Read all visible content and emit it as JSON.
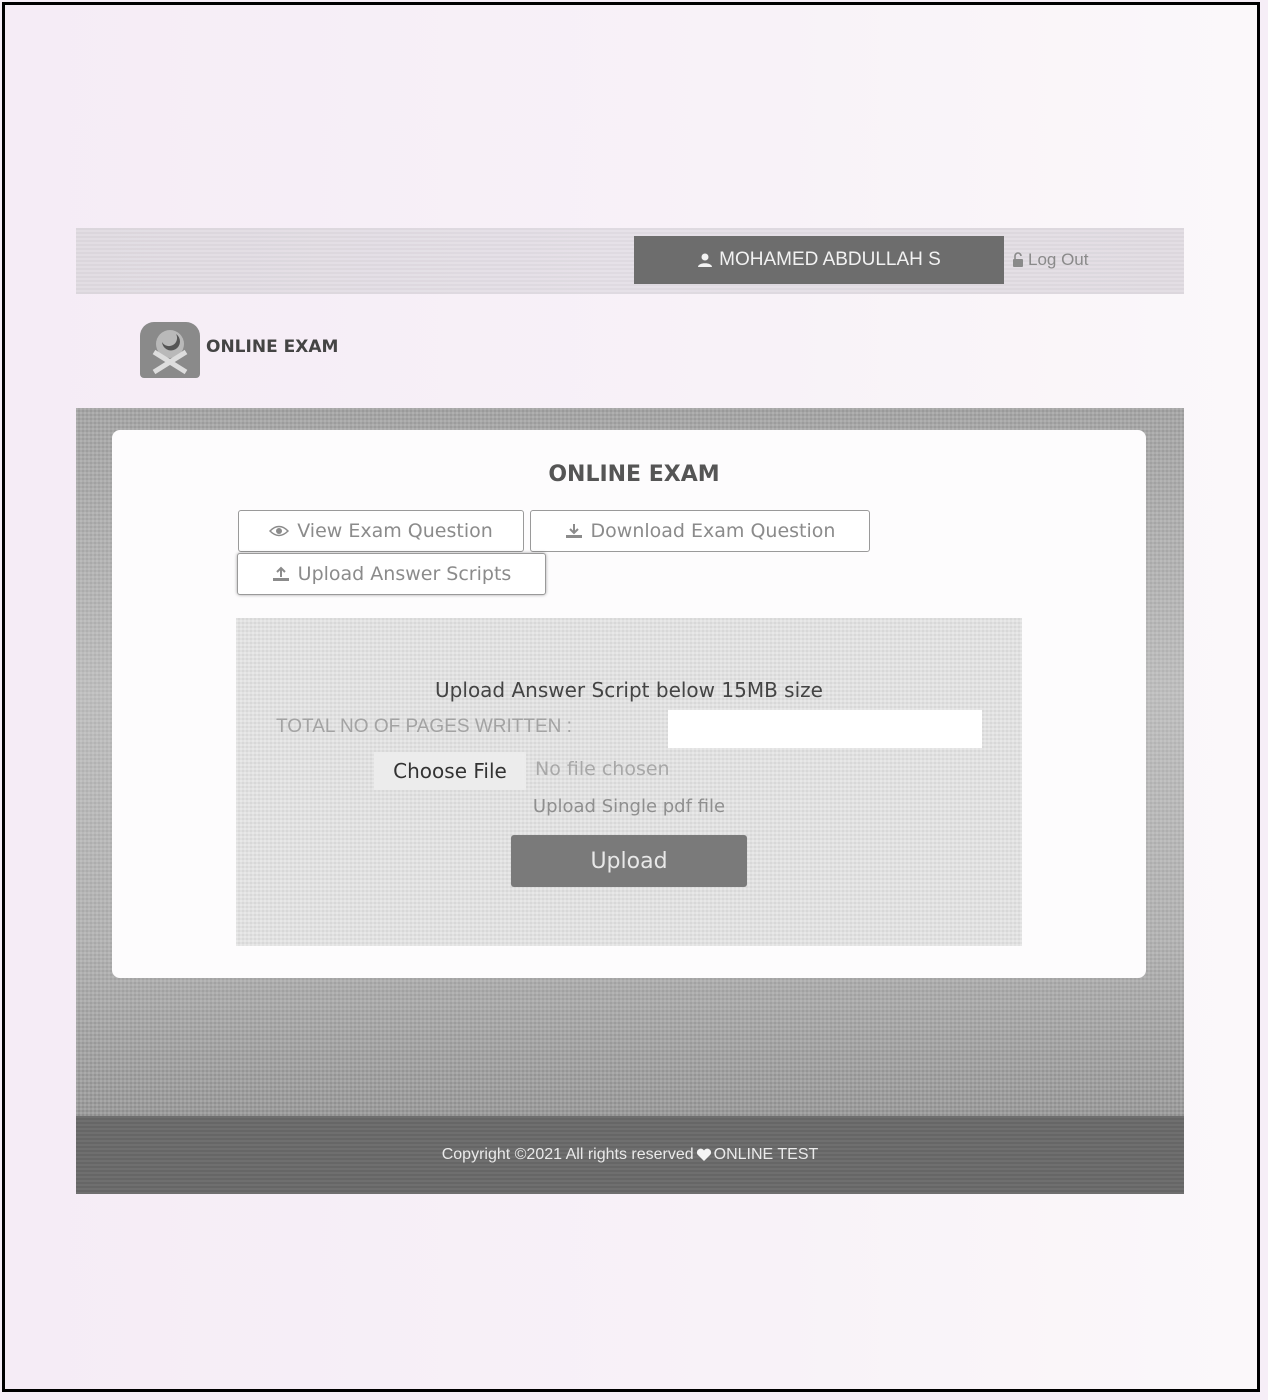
{
  "header": {
    "user_name": "MOHAMED ABDULLAH S",
    "logout_label": "Log Out"
  },
  "brand": {
    "name": "ONLINE EXAM"
  },
  "card": {
    "title": "ONLINE EXAM",
    "tabs": [
      {
        "label": "View Exam Question",
        "icon": "eye-icon"
      },
      {
        "label": "Download Exam Question",
        "icon": "download-icon"
      },
      {
        "label": "Upload Answer Scripts",
        "icon": "upload-icon"
      }
    ]
  },
  "upload": {
    "heading": "Upload Answer Script below 15MB size",
    "pages_label": "TOTAL NO OF PAGES WRITTEN :",
    "pages_value": "",
    "choose_file_label": "Choose File",
    "no_file_text": "No file chosen",
    "note": "Upload Single pdf file",
    "submit_label": "Upload"
  },
  "footer": {
    "text_before": "Copyright ©2021 All rights reserved ",
    "text_after": "ONLINE TEST"
  }
}
